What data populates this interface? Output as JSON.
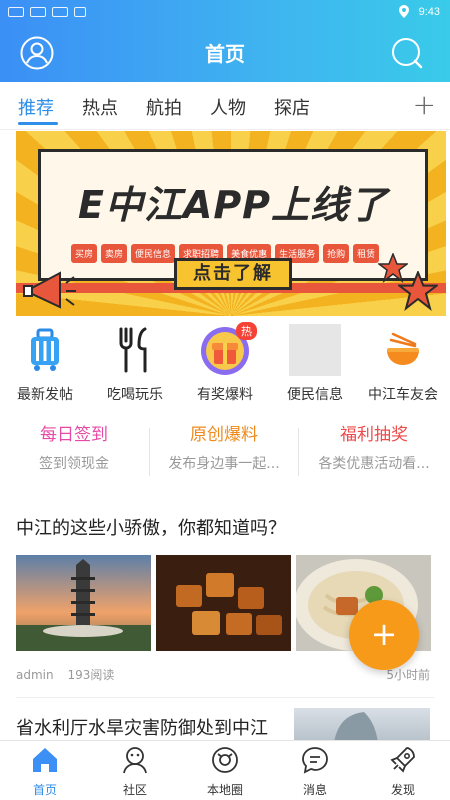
{
  "status_bar": {
    "time": "9:43"
  },
  "header": {
    "title": "首页"
  },
  "tabs": [
    {
      "label": "推荐",
      "active": true
    },
    {
      "label": "热点"
    },
    {
      "label": "航拍"
    },
    {
      "label": "人物"
    },
    {
      "label": "探店"
    }
  ],
  "tab_add": "+",
  "banner": {
    "title": "E中江APP上线了",
    "tags": [
      "买房",
      "卖房",
      "便民信息",
      "求职招聘",
      "美食优惠",
      "生活服务",
      "抢购",
      "租赁"
    ],
    "button": "点击了解"
  },
  "shortcuts": [
    {
      "label": "最新发帖",
      "icon": "suitcase-icon"
    },
    {
      "label": "吃喝玩乐",
      "icon": "fork-knife-icon"
    },
    {
      "label": "有奖爆料",
      "icon": "gift-icon",
      "badge": "热"
    },
    {
      "label": "便民信息",
      "icon": "placeholder-icon"
    },
    {
      "label": "中江车友会",
      "icon": "noodle-bowl-icon"
    }
  ],
  "features": [
    {
      "title": "每日签到",
      "sub": "签到领现金",
      "color": "#e64aa6"
    },
    {
      "title": "原创爆料",
      "sub": "发布身边事一起...",
      "color": "#f08a1c"
    },
    {
      "title": "福利抽奖",
      "sub": "各类优惠活动看...",
      "color": "#ef4a4a"
    }
  ],
  "article": {
    "title": "中江的这些小骄傲，你都知道吗？",
    "author": "admin",
    "reads": "193阅读",
    "time": "5小时前"
  },
  "article2": {
    "title": "省水利厅水旱灾害防御处到中江"
  },
  "fab": "+",
  "bottom_nav": [
    {
      "label": "首页",
      "icon": "home-icon",
      "active": true
    },
    {
      "label": "社区",
      "icon": "community-icon"
    },
    {
      "label": "本地圈",
      "icon": "local-circle-icon"
    },
    {
      "label": "消息",
      "icon": "message-icon"
    },
    {
      "label": "发现",
      "icon": "rocket-icon"
    }
  ],
  "colors": {
    "primary": "#2f8ee8",
    "fab": "#f79a1a"
  }
}
